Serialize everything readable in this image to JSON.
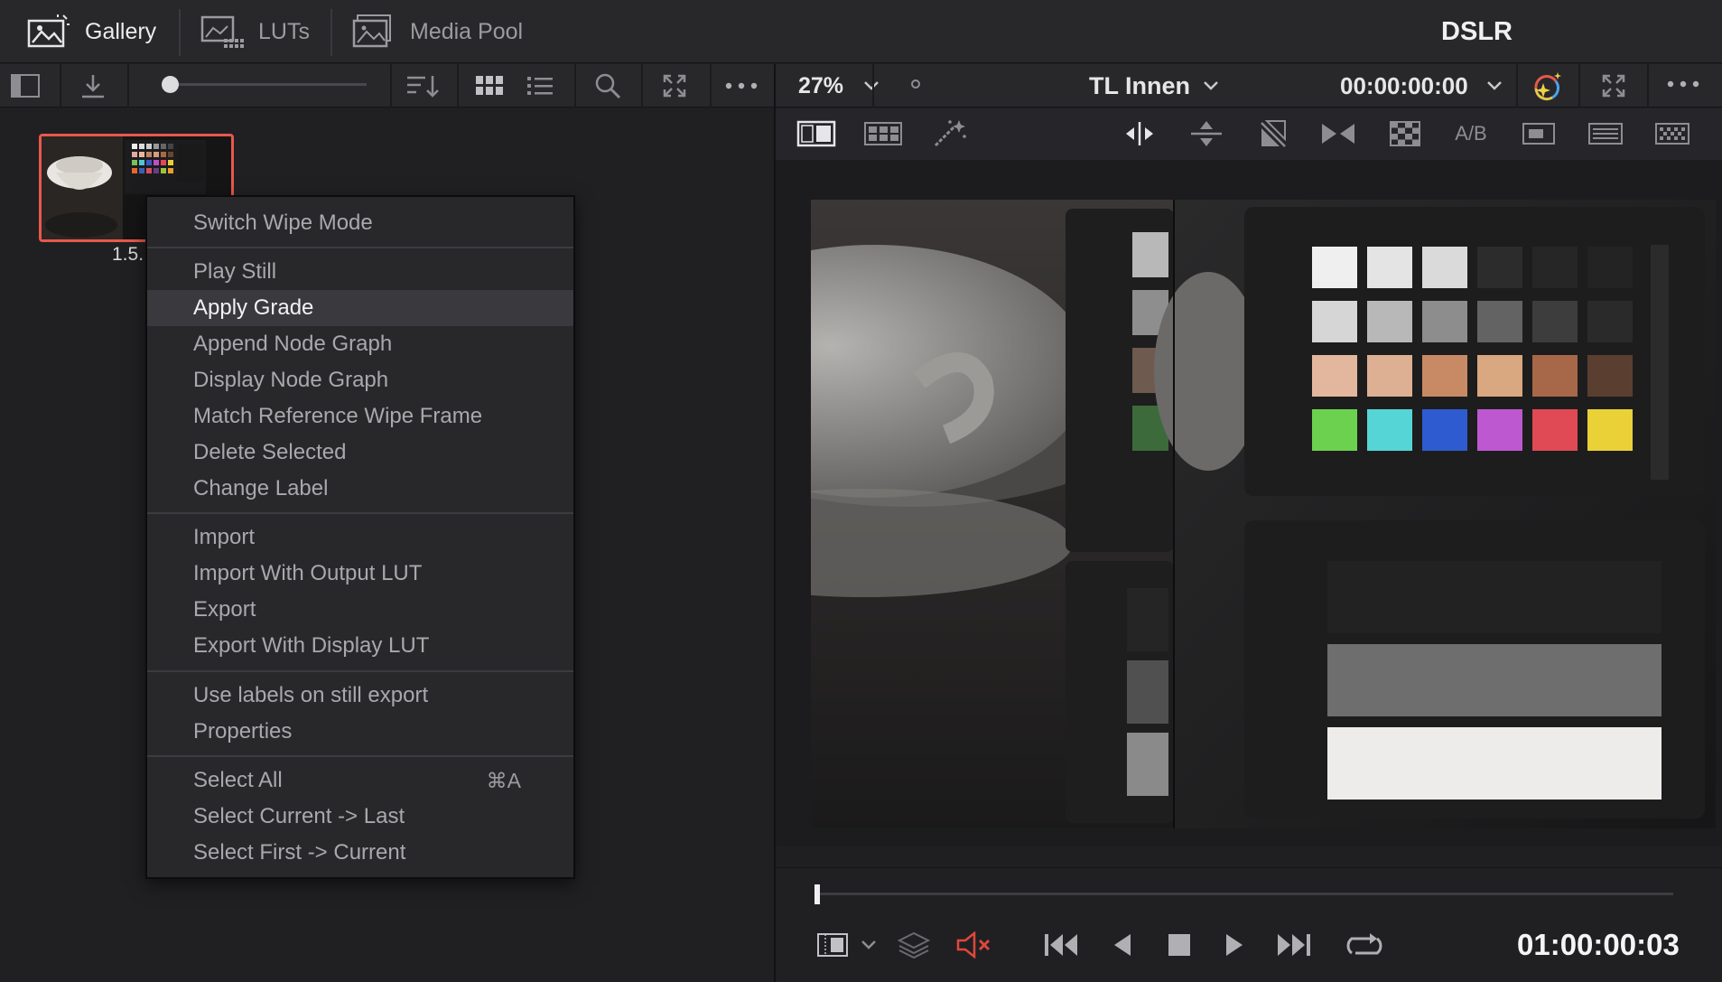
{
  "tabs": [
    {
      "label": "Gallery",
      "icon": "gallery-icon",
      "active": true
    },
    {
      "label": "LUTs",
      "icon": "luts-icon",
      "active": false
    },
    {
      "label": "Media Pool",
      "icon": "media-pool-icon",
      "active": false
    }
  ],
  "viewer": {
    "title": "DSLR",
    "zoom": "27%",
    "clip_name": "TL Innen",
    "timecode_top": "00:00:00:00",
    "timecode_bottom": "01:00:00:03",
    "ab_label": "A/B",
    "scrub_position": 0.0
  },
  "gallery": {
    "still_label": "1.5."
  },
  "context_menu": {
    "groups": [
      [
        {
          "label": "Switch Wipe Mode"
        }
      ],
      [
        {
          "label": "Play Still"
        },
        {
          "label": "Apply Grade",
          "highlighted": true
        },
        {
          "label": "Append Node Graph"
        },
        {
          "label": "Display Node Graph"
        },
        {
          "label": "Match Reference Wipe Frame"
        },
        {
          "label": "Delete Selected"
        },
        {
          "label": "Change Label"
        }
      ],
      [
        {
          "label": "Import"
        },
        {
          "label": "Import With Output LUT"
        },
        {
          "label": "Export"
        },
        {
          "label": "Export With Display LUT"
        }
      ],
      [
        {
          "label": "Use labels on still export"
        },
        {
          "label": "Properties"
        }
      ],
      [
        {
          "label": "Select All",
          "shortcut": "⌘A"
        },
        {
          "label": "Select Current -> Last"
        },
        {
          "label": "Select First -> Current"
        }
      ]
    ]
  },
  "colors": {
    "accent_selection": "#e8584b",
    "mute_icon": "#e0473c",
    "background": "#1f1f22"
  }
}
